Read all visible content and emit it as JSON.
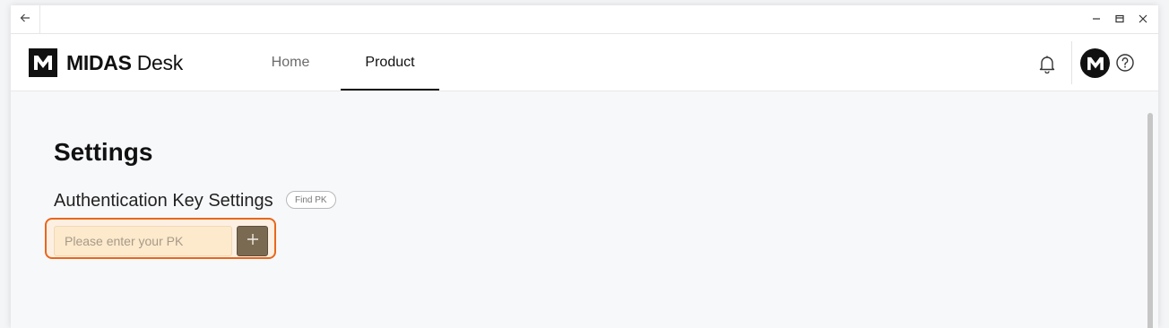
{
  "brand": {
    "name_bold": "MIDAS",
    "name_light": "Desk"
  },
  "nav": {
    "tabs": [
      {
        "label": "Home"
      },
      {
        "label": "Product"
      }
    ],
    "active": "Product"
  },
  "settings": {
    "title": "Settings",
    "section_title": "Authentication Key Settings",
    "find_pk_label": "Find PK",
    "pk_input": {
      "value": "",
      "placeholder": "Please enter your PK"
    }
  },
  "icons": {
    "back": "arrow-left-icon",
    "minimize": "minimize-icon",
    "restore": "restore-icon",
    "close": "close-icon",
    "logo": "midas-m-logo",
    "bell": "bell-icon",
    "avatar": "midas-m-avatar",
    "help": "help-circle-icon",
    "add": "plus-icon"
  },
  "colors": {
    "accent_outline": "#e8671c",
    "input_bg": "#fde9cc",
    "add_button_bg": "#7a6a52",
    "brand_black": "#111111"
  }
}
